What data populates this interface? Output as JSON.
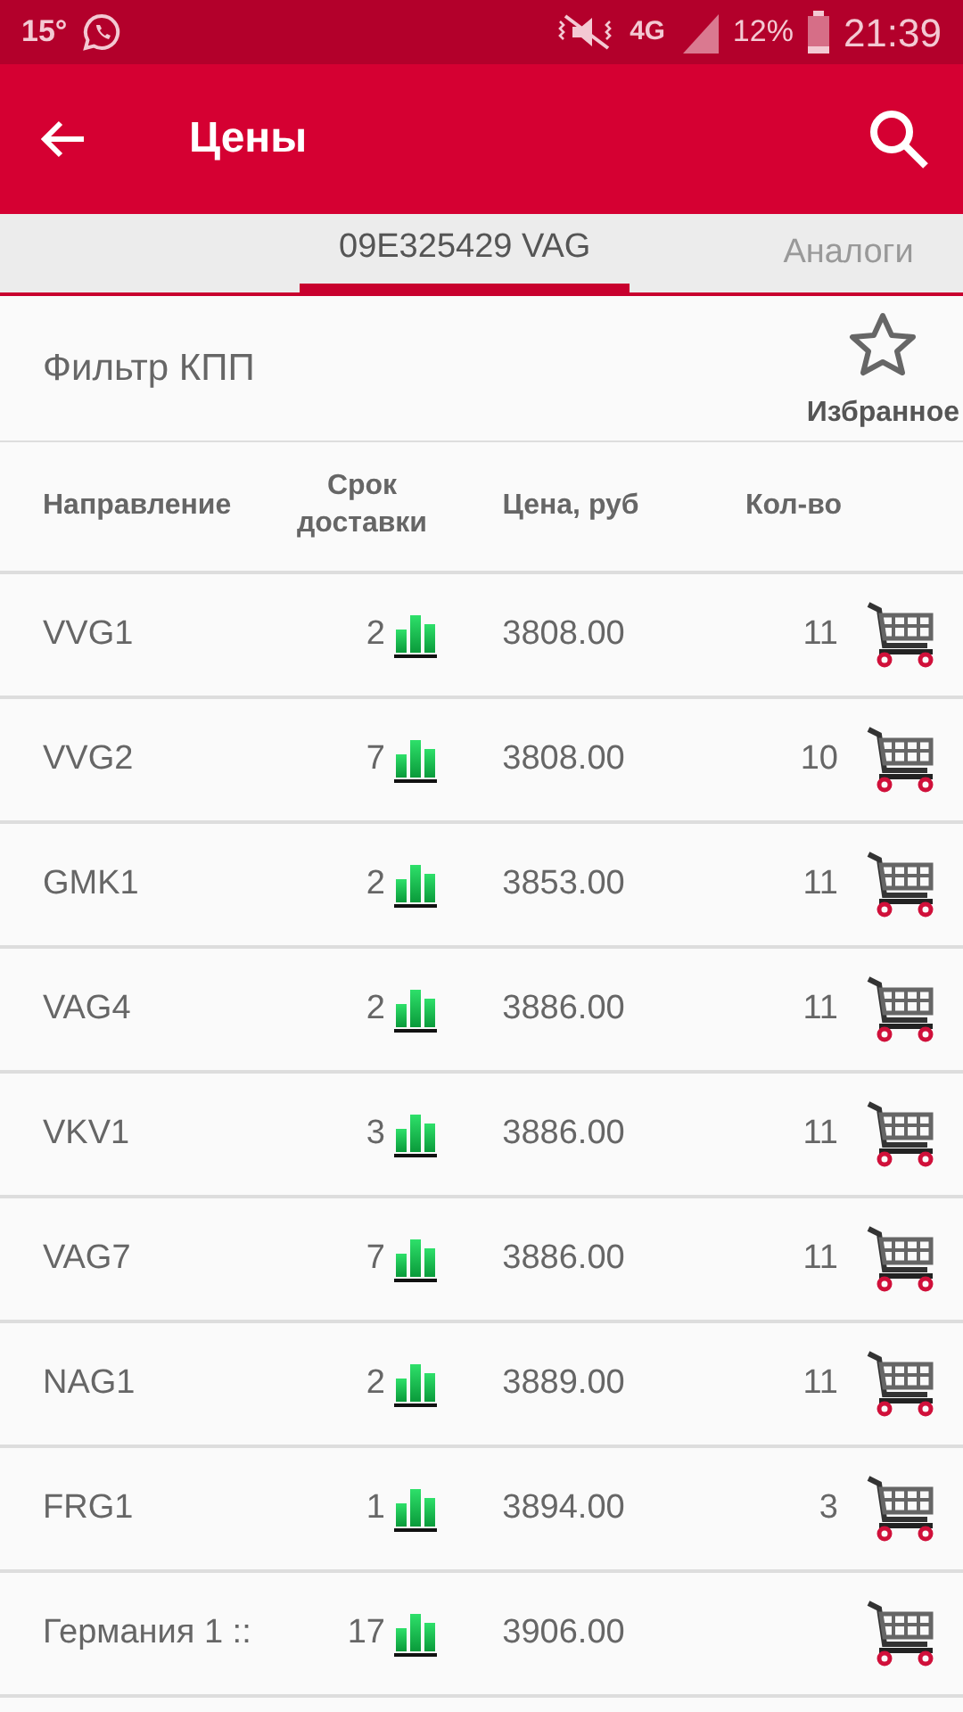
{
  "status_bar": {
    "temperature": "15°",
    "network": "4G",
    "battery": "12%",
    "time": "21:39"
  },
  "app_bar": {
    "title": "Цены"
  },
  "tabs": [
    {
      "label": "09E325429 VAG",
      "selected": true
    },
    {
      "label": "Аналоги",
      "selected": false
    }
  ],
  "filter": {
    "title": "Фильтр КПП",
    "favorite_label": "Избранное"
  },
  "table": {
    "columns": [
      "Направление",
      "Срок доставки",
      "Цена, руб",
      "Кол-во"
    ],
    "rows": [
      {
        "direction": "VVG1",
        "delivery": "2",
        "price": "3808.00",
        "qty": "11"
      },
      {
        "direction": "VVG2",
        "delivery": "7",
        "price": "3808.00",
        "qty": "10"
      },
      {
        "direction": "GMK1",
        "delivery": "2",
        "price": "3853.00",
        "qty": "11"
      },
      {
        "direction": "VAG4",
        "delivery": "2",
        "price": "3886.00",
        "qty": "11"
      },
      {
        "direction": "VKV1",
        "delivery": "3",
        "price": "3886.00",
        "qty": "11"
      },
      {
        "direction": "VAG7",
        "delivery": "7",
        "price": "3886.00",
        "qty": "11"
      },
      {
        "direction": "NAG1",
        "delivery": "2",
        "price": "3889.00",
        "qty": "11"
      },
      {
        "direction": "FRG1",
        "delivery": "1",
        "price": "3894.00",
        "qty": "3"
      },
      {
        "direction": "Германия 1 ::",
        "delivery": "17",
        "price": "3906.00"
      }
    ]
  }
}
